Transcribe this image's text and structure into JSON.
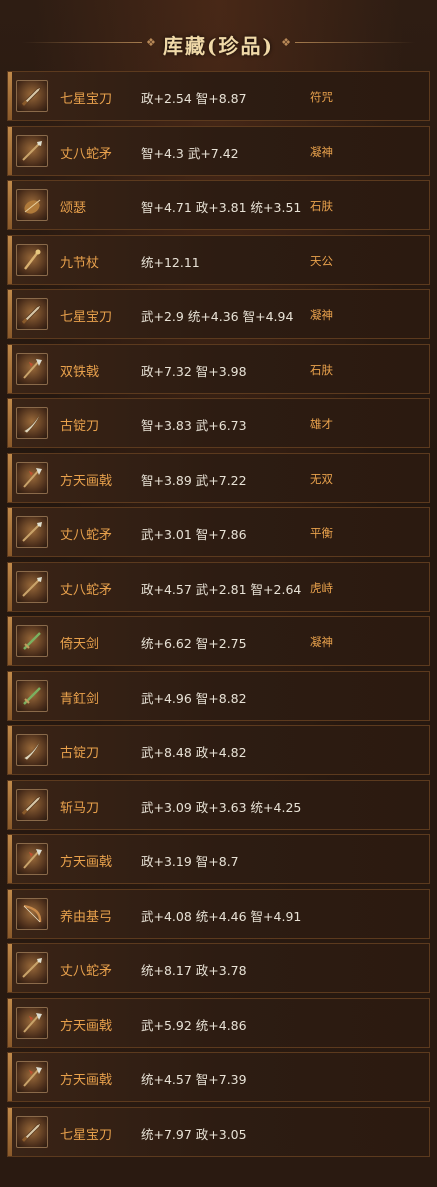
{
  "header": {
    "title": "库藏(珍品)"
  },
  "items": [
    {
      "name": "七星宝刀",
      "attrs": "政+2.54 智+8.87",
      "skill": "符咒",
      "icon": "blade-icon"
    },
    {
      "name": "丈八蛇矛",
      "attrs": "智+4.3 武+7.42",
      "skill": "凝神",
      "icon": "spear-icon"
    },
    {
      "name": "颂瑟",
      "attrs": "智+4.71 政+3.81 统+3.51",
      "skill": "石肤",
      "icon": "lute-icon"
    },
    {
      "name": "九节杖",
      "attrs": "统+12.11",
      "skill": "天公",
      "icon": "staff-icon"
    },
    {
      "name": "七星宝刀",
      "attrs": "武+2.9 统+4.36 智+4.94",
      "skill": "凝神",
      "icon": "blade-icon"
    },
    {
      "name": "双铁戟",
      "attrs": "政+7.32 智+3.98",
      "skill": "石肤",
      "icon": "halberd-icon"
    },
    {
      "name": "古锭刀",
      "attrs": "智+3.83 武+6.73",
      "skill": "雄才",
      "icon": "sabre-icon"
    },
    {
      "name": "方天画戟",
      "attrs": "智+3.89 武+7.22",
      "skill": "无双",
      "icon": "halberd-icon"
    },
    {
      "name": "丈八蛇矛",
      "attrs": "武+3.01 智+7.86",
      "skill": "平衡",
      "icon": "spear-icon"
    },
    {
      "name": "丈八蛇矛",
      "attrs": "政+4.57 武+2.81 智+2.64",
      "skill": "虎峙",
      "icon": "spear-icon"
    },
    {
      "name": "倚天剑",
      "attrs": "统+6.62 智+2.75",
      "skill": "凝神",
      "icon": "sword-icon"
    },
    {
      "name": "青釭剑",
      "attrs": "武+4.96 智+8.82",
      "skill": "",
      "icon": "sword-icon"
    },
    {
      "name": "古锭刀",
      "attrs": "武+8.48 政+4.82",
      "skill": "",
      "icon": "sabre-icon"
    },
    {
      "name": "斩马刀",
      "attrs": "武+3.09 政+3.63 统+4.25",
      "skill": "",
      "icon": "blade-icon"
    },
    {
      "name": "方天画戟",
      "attrs": "政+3.19 智+8.7",
      "skill": "",
      "icon": "halberd-icon"
    },
    {
      "name": "养由基弓",
      "attrs": "武+4.08 统+4.46 智+4.91",
      "skill": "",
      "icon": "bow-icon"
    },
    {
      "name": "丈八蛇矛",
      "attrs": "统+8.17 政+3.78",
      "skill": "",
      "icon": "spear-icon"
    },
    {
      "name": "方天画戟",
      "attrs": "武+5.92 统+4.86",
      "skill": "",
      "icon": "halberd-icon"
    },
    {
      "name": "方天画戟",
      "attrs": "统+4.57 智+7.39",
      "skill": "",
      "icon": "halberd-icon"
    },
    {
      "name": "七星宝刀",
      "attrs": "统+7.97 政+3.05",
      "skill": "",
      "icon": "blade-icon"
    }
  ]
}
